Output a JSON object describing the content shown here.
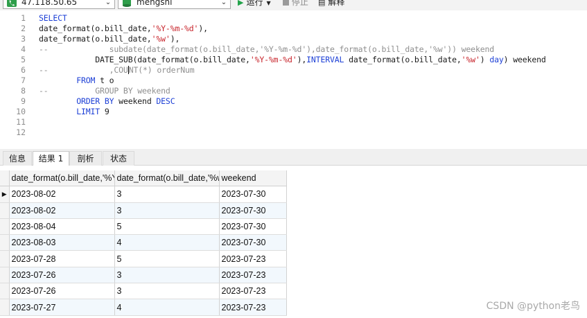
{
  "toolbar": {
    "connection": "47.118.50.65",
    "database": "mengshi",
    "run_label": "运行",
    "stop_label": "停止",
    "explain_label": "解释"
  },
  "editor": {
    "line_numbers": [
      "1",
      "2",
      "3",
      "4",
      "5",
      "6",
      "7",
      "8",
      "9",
      "10",
      "11",
      "12"
    ],
    "lines": {
      "l1": {
        "kw": "SELECT"
      },
      "l2": {
        "a": "date_format(o.bill_date,",
        "s": "'%Y-%m-%d'",
        "b": "),"
      },
      "l3": {
        "a": "date_format(o.bill_date,",
        "s": "'%w'",
        "b": "),"
      },
      "l4": {
        "c": "--             subdate(date_format(o.bill_date,'%Y-%m-%d'),date_format(o.bill_date,'%w')) weekend"
      },
      "l5": {
        "a": "            DATE_SUB(date_format(o.bill_date,",
        "s1": "'%Y-%m-%d'",
        "b": "),",
        "kw": "INTERVAL",
        "c2": " date_format(o.bill_date,",
        "s2": "'%w'",
        "d": ") ",
        "kw2": "day",
        "e": ") weekend"
      },
      "l6": {
        "c_pre": "--             ,COU",
        "c_post": "NT(*) orderNum"
      },
      "l7": {
        "kw": "FROM",
        "a": " t o"
      },
      "l8": {
        "c": "--          GROUP BY weekend"
      },
      "l9": {
        "kw": "ORDER BY",
        "a": " weekend ",
        "kw2": "DESC"
      },
      "l10": {
        "kw": "LIMIT",
        "num": " 9"
      }
    }
  },
  "tabs": [
    {
      "label": "信息",
      "active": false
    },
    {
      "label": "结果 1",
      "active": true
    },
    {
      "label": "剖析",
      "active": false
    },
    {
      "label": "状态",
      "active": false
    }
  ],
  "grid": {
    "columns": [
      "date_format(o.bill_date,'%Y-%m-%d')",
      "date_format(o.bill_date,'%w')",
      "weekend"
    ],
    "rows": [
      [
        "2023-08-02",
        "3",
        "2023-07-30"
      ],
      [
        "2023-08-02",
        "3",
        "2023-07-30"
      ],
      [
        "2023-08-04",
        "5",
        "2023-07-30"
      ],
      [
        "2023-08-03",
        "4",
        "2023-07-30"
      ],
      [
        "2023-07-28",
        "5",
        "2023-07-23"
      ],
      [
        "2023-07-26",
        "3",
        "2023-07-23"
      ],
      [
        "2023-07-26",
        "3",
        "2023-07-23"
      ],
      [
        "2023-07-27",
        "4",
        "2023-07-23"
      ]
    ],
    "current_row_marker": "▶"
  },
  "watermark": "CSDN @python老鸟",
  "colors": {
    "keyword": "#1c3fd6",
    "string": "#c8262d",
    "comment": "#8f8f8f",
    "run_icon": "#22a34a"
  }
}
